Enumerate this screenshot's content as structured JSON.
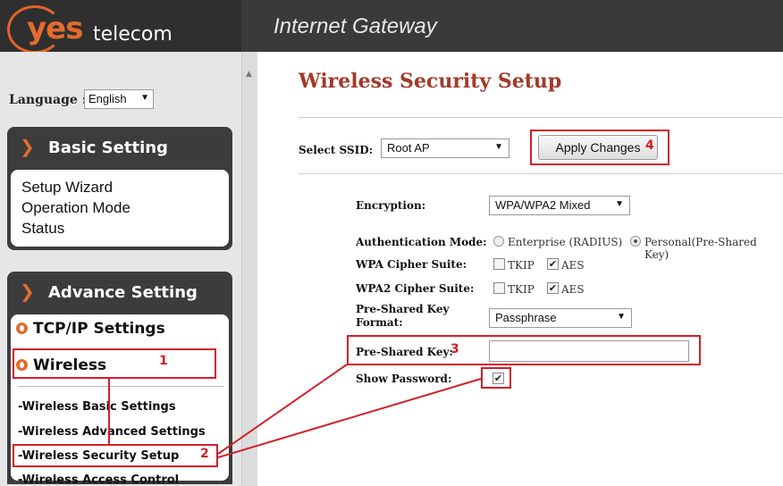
{
  "header": {
    "brand_yes": "yes",
    "brand_telecom": "telecom",
    "title": "Internet Gateway"
  },
  "sidebar": {
    "language_label": "Language :",
    "language_value": "English",
    "basic_setting": {
      "title": "Basic Setting",
      "items": [
        "Setup Wizard",
        "Operation Mode",
        "Status"
      ]
    },
    "advance_setting": {
      "title": "Advance Setting",
      "tcpip": "TCP/IP Settings",
      "wireless": "Wireless",
      "sub_items": [
        "-Wireless Basic Settings",
        "-Wireless Advanced Settings",
        "-Wireless Security Setup",
        "-Wireless Access Control"
      ]
    }
  },
  "main": {
    "title": "Wireless Security Setup",
    "select_ssid_label": "Select SSID:",
    "ssid_value": "Root AP",
    "apply_button": "Apply Changes",
    "encryption_label": "Encryption:",
    "encryption_value": "WPA/WPA2 Mixed",
    "auth_mode_label": "Authentication Mode:",
    "auth_options": [
      "Enterprise (RADIUS)",
      "Personal(Pre-Shared Key)"
    ],
    "auth_selected": "Personal(Pre-Shared Key)",
    "wpa_cipher_label": "WPA Cipher Suite:",
    "wpa2_cipher_label": "WPA2 Cipher Suite:",
    "cipher_options": {
      "tkip": "TKIP",
      "aes": "AES"
    },
    "psk_format_label": "Pre-Shared Key Format:",
    "psk_format_value": "Passphrase",
    "psk_label": "Pre-Shared Key:",
    "psk_value": "",
    "show_password_label": "Show Password:"
  },
  "annotations": {
    "n1": "1",
    "n2": "2",
    "n3": "3",
    "n4": "4",
    "color": "#d21f2a"
  },
  "colors": {
    "accent_orange": "#e46b2d",
    "title_red": "#a33a2a",
    "header_dark": "#3a3a3a"
  }
}
